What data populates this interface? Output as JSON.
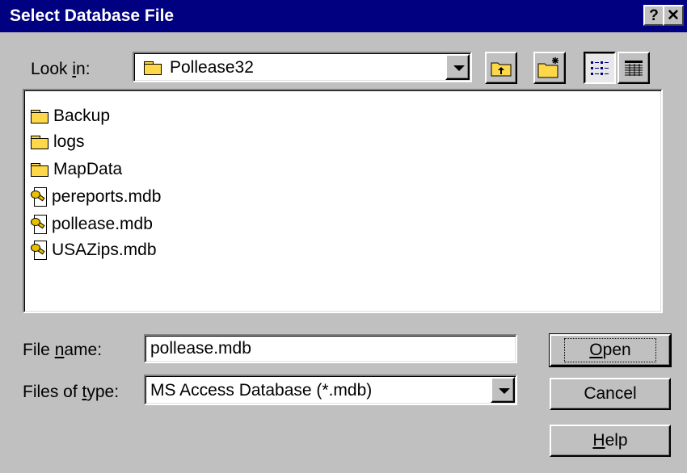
{
  "window": {
    "title": "Select Database File",
    "help_glyph": "?",
    "close_glyph": "✕"
  },
  "lookin": {
    "label_pre": "Look ",
    "label_u": "i",
    "label_post": "n:",
    "value": "Pollease32",
    "icon": "folder-icon"
  },
  "toolbar": {
    "up_icon": "up-one-level-icon",
    "new_folder_icon": "new-folder-icon",
    "list_icon": "list-view-icon",
    "details_icon": "details-view-icon"
  },
  "files": [
    {
      "name": "Backup",
      "icon": "folder-icon"
    },
    {
      "name": "logs",
      "icon": "folder-icon"
    },
    {
      "name": "MapData",
      "icon": "folder-icon"
    },
    {
      "name": "pereports.mdb",
      "icon": "database-file-icon"
    },
    {
      "name": "pollease.mdb",
      "icon": "database-file-icon"
    },
    {
      "name": "USAZips.mdb",
      "icon": "database-file-icon"
    }
  ],
  "filename": {
    "label_pre": "File ",
    "label_u": "n",
    "label_post": "ame:",
    "value": "pollease.mdb"
  },
  "filetype": {
    "label_pre": "Files of ",
    "label_u": "t",
    "label_post": "ype:",
    "value": "MS Access Database (*.mdb)"
  },
  "buttons": {
    "open_u": "O",
    "open_rest": "pen",
    "cancel": "Cancel",
    "help_u": "H",
    "help_rest": "elp"
  }
}
